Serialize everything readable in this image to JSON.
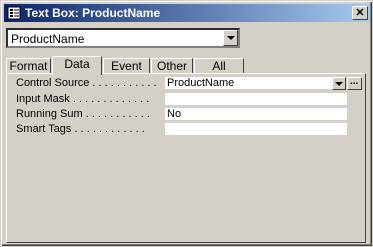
{
  "window": {
    "title": "Text Box: ProductName",
    "close_glyph": "✕"
  },
  "object_selector": {
    "value": "ProductName"
  },
  "tabs": [
    {
      "label": "Format",
      "active": false
    },
    {
      "label": "Data",
      "active": true
    },
    {
      "label": "Event",
      "active": false
    },
    {
      "label": "Other",
      "active": false
    },
    {
      "label": "All",
      "active": false
    }
  ],
  "properties": [
    {
      "label": "Control Source . . . . . . . . . . .",
      "value": "ProductName"
    },
    {
      "label": "Input Mask . . . . . . . . . . . . .",
      "value": ""
    },
    {
      "label": "Running Sum . . . . . . . . . . .",
      "value": "No"
    },
    {
      "label": "Smart Tags . . . . . . . . . . . .",
      "value": ""
    }
  ],
  "icons": {
    "window": "properties-window-icon",
    "dropdown": "chevron-down-icon",
    "builder": "ellipsis-icon"
  },
  "colors": {
    "title_gradient_start": "#0a246a",
    "title_gradient_end": "#a6caf0",
    "face": "#d4d0c8"
  }
}
